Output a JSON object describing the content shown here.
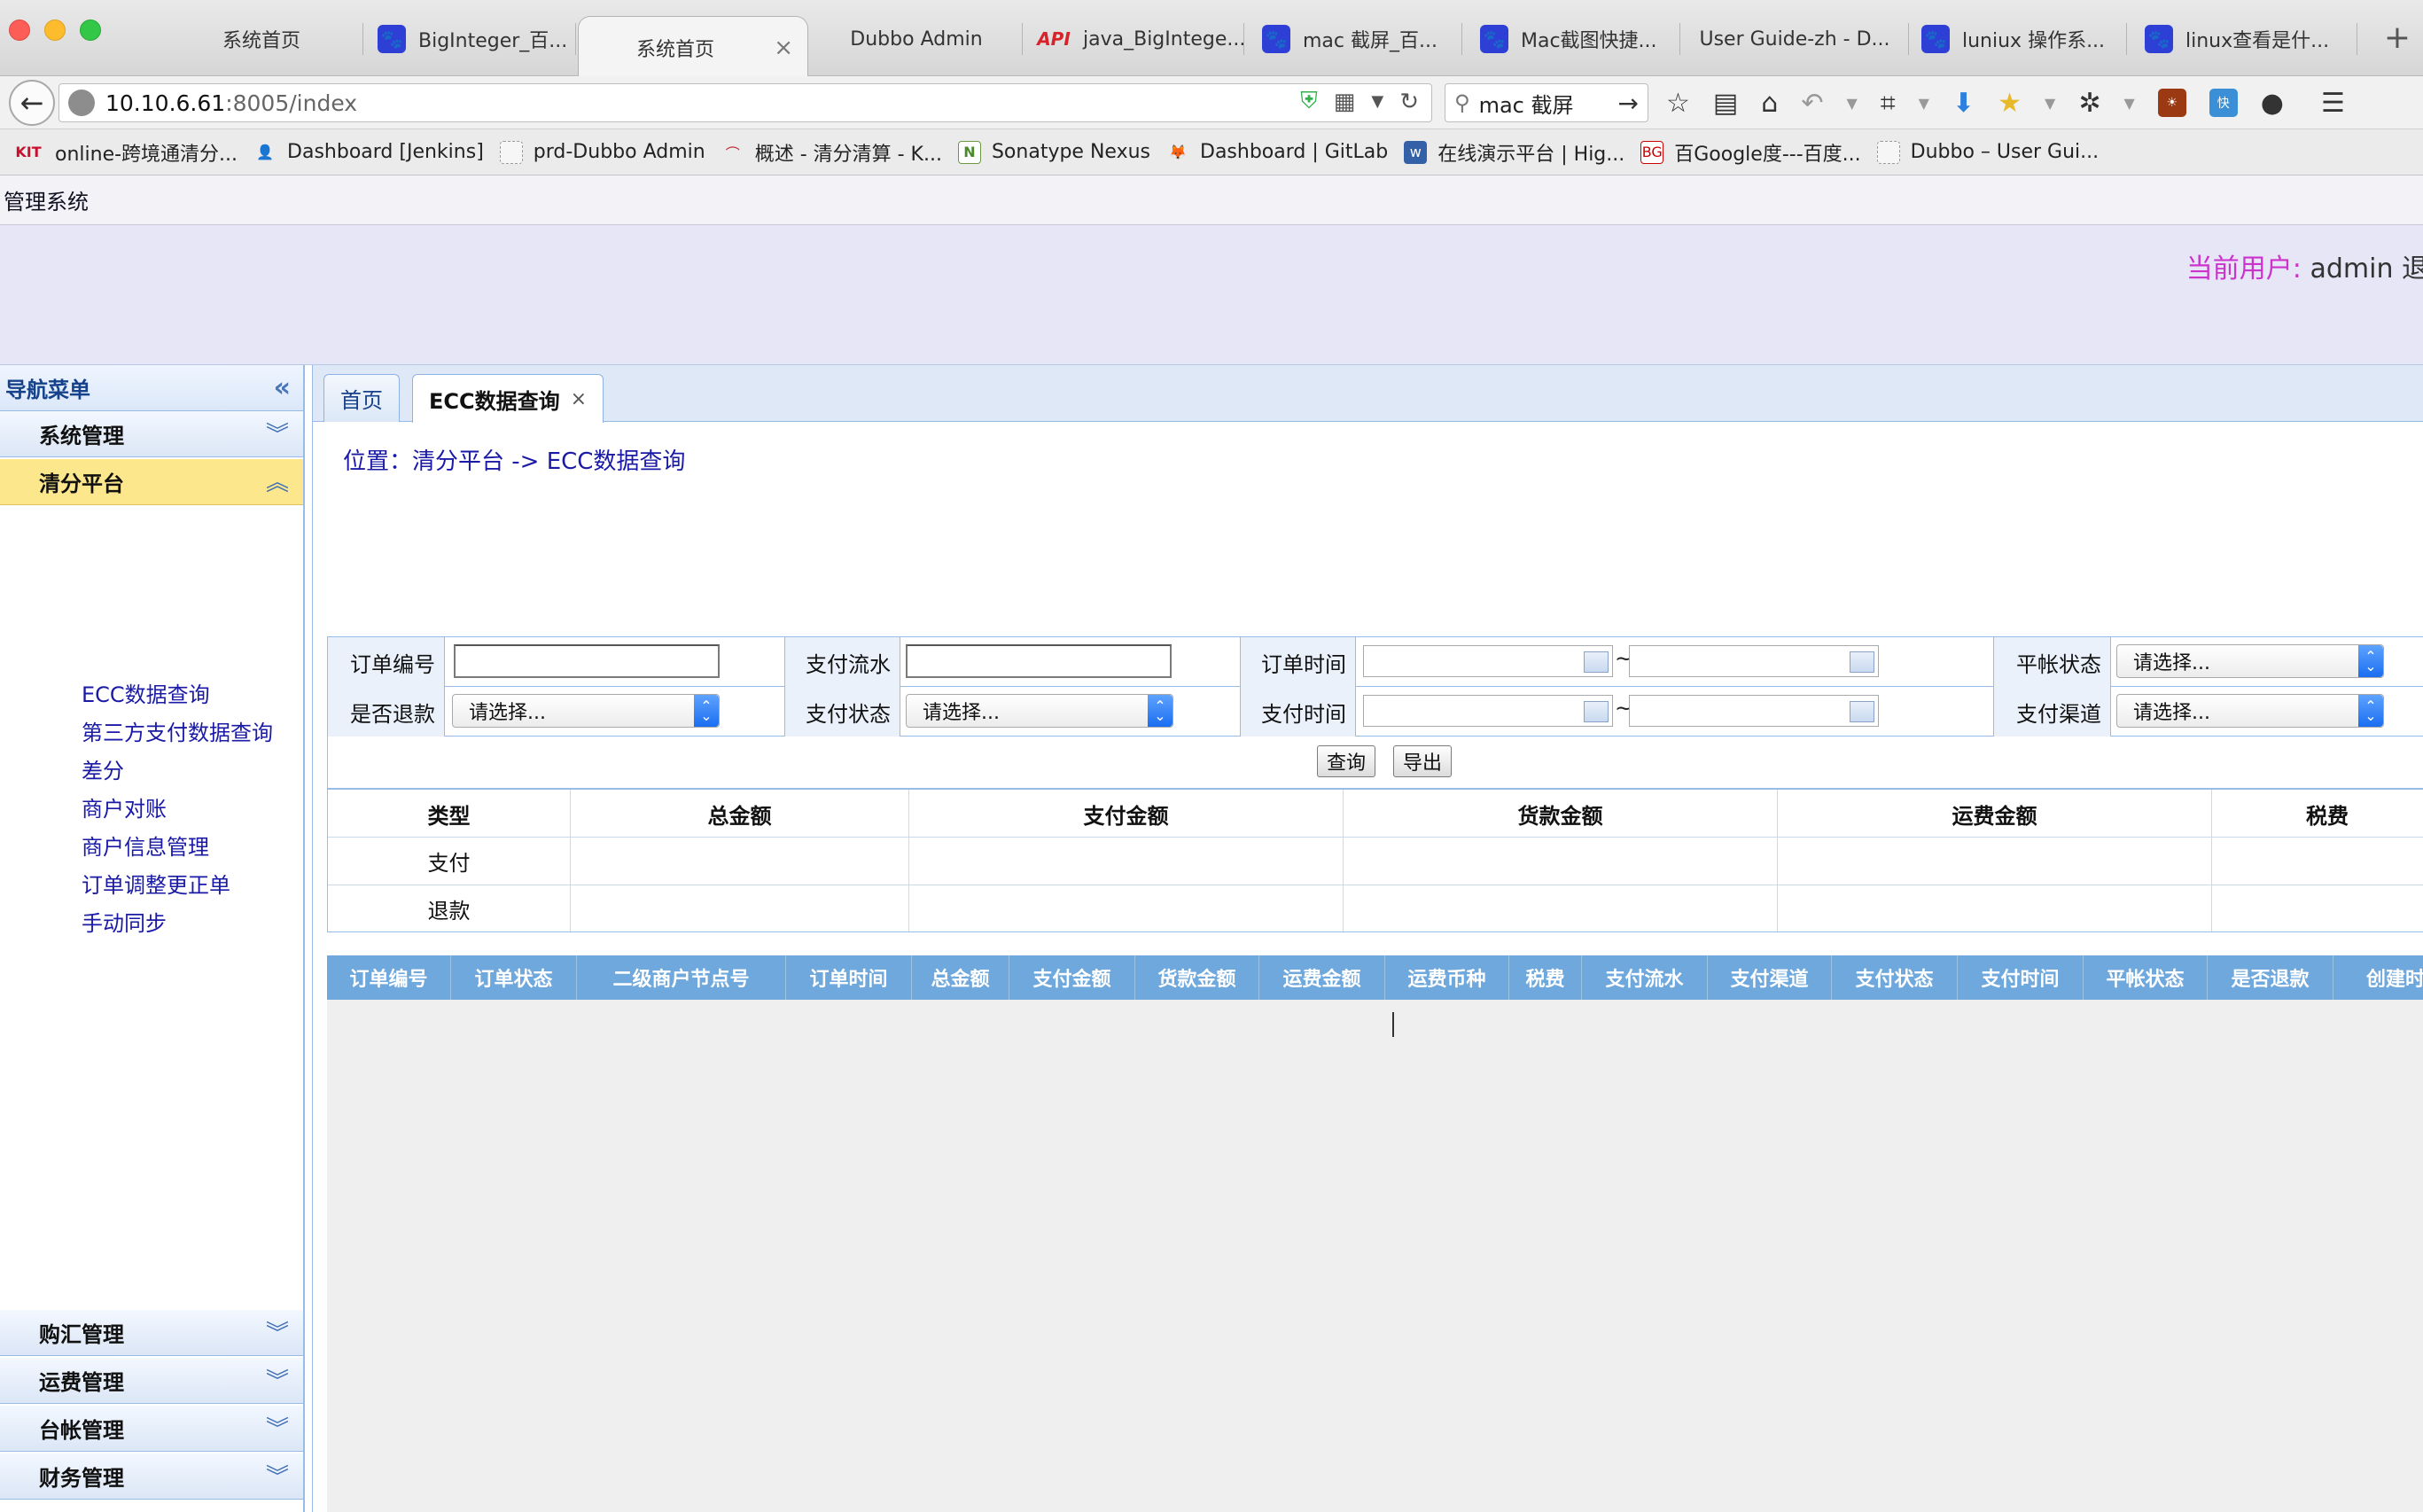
{
  "browser": {
    "tabs": [
      {
        "label": "系统首页",
        "icon": "none",
        "active": false
      },
      {
        "label": "BigInteger_百...",
        "icon": "paw-icon",
        "active": false
      },
      {
        "label": "系统首页",
        "icon": "none",
        "active": true
      },
      {
        "label": "Dubbo Admin",
        "icon": "none",
        "active": false
      },
      {
        "label": "java_BigIntege...",
        "icon": "api-icon",
        "active": false
      },
      {
        "label": "mac 截屏_百...",
        "icon": "paw-icon",
        "active": false
      },
      {
        "label": "Mac截图快捷...",
        "icon": "paw-icon",
        "active": false
      },
      {
        "label": "User Guide-zh - D...",
        "icon": "none",
        "active": false
      },
      {
        "label": "luniux 操作系...",
        "icon": "paw-icon",
        "active": false
      },
      {
        "label": "linux查看是什...",
        "icon": "paw-icon",
        "active": false
      }
    ],
    "url_host": "10.10.6.61",
    "url_rest": ":8005/index",
    "search_value": "mac 截屏",
    "bookmarks": [
      {
        "label": "online-跨境通清分...",
        "icon": "kit-logo"
      },
      {
        "label": "Dashboard [Jenkins]",
        "icon": "jenkins-icon"
      },
      {
        "label": "prd-Dubbo Admin",
        "icon": "blank-page-icon"
      },
      {
        "label": "概述 - 清分清算 - K...",
        "icon": "rainbow-icon"
      },
      {
        "label": "Sonatype Nexus",
        "icon": "nexus-icon"
      },
      {
        "label": "Dashboard | GitLab",
        "icon": "gitlab-icon"
      },
      {
        "label": "在线演示平台 | Hig...",
        "icon": "globe-icon"
      },
      {
        "label": "百Google度---百度...",
        "icon": "bg-icon"
      },
      {
        "label": "Dubbo – User Gui...",
        "icon": "blank-page-icon"
      }
    ]
  },
  "app": {
    "system_title": "管理系统",
    "user_label": "当前用户:",
    "user_name": "admin 退"
  },
  "sidebar": {
    "title": "导航菜单",
    "groups_top": [
      {
        "label": "系统管理",
        "open": false
      },
      {
        "label": "清分平台",
        "open": true
      }
    ],
    "items": [
      "ECC数据查询",
      "第三方支付数据查询",
      "差分",
      "商户对账",
      "商户信息管理",
      "订单调整更正单",
      "手动同步"
    ],
    "groups_bottom": [
      {
        "label": "购汇管理"
      },
      {
        "label": "运费管理"
      },
      {
        "label": "台帐管理"
      },
      {
        "label": "财务管理"
      }
    ]
  },
  "main": {
    "tabs": [
      {
        "label": "首页",
        "active": false
      },
      {
        "label": "ECC数据查询",
        "active": true,
        "close": "×"
      }
    ],
    "location": "位置：清分平台 -> ECC数据查询",
    "filters": {
      "order_no": "订单编号",
      "pay_serial": "支付流水",
      "order_time": "订单时间",
      "reconcile_status": "平帐状态",
      "is_refund": "是否退款",
      "pay_status": "支付状态",
      "pay_time": "支付时间",
      "pay_channel": "支付渠道",
      "select_placeholder": "请选择...",
      "tilde": "~"
    },
    "buttons": {
      "query": "查询",
      "export": "导出"
    },
    "summary": {
      "headers": [
        "类型",
        "总金额",
        "支付金额",
        "货款金额",
        "运费金额",
        "税费"
      ],
      "rows": [
        [
          "支付",
          "",
          "",
          "",
          "",
          ""
        ],
        [
          "退款",
          "",
          "",
          "",
          "",
          ""
        ]
      ]
    },
    "detail_headers": [
      "订单编号",
      "订单状态",
      "二级商户节点号",
      "订单时间",
      "总金额",
      "支付金额",
      "货款金额",
      "运费金额",
      "运费币种",
      "税费",
      "支付流水",
      "支付渠道",
      "支付状态",
      "支付时间",
      "平帐状态",
      "是否退款",
      "创建时"
    ]
  }
}
